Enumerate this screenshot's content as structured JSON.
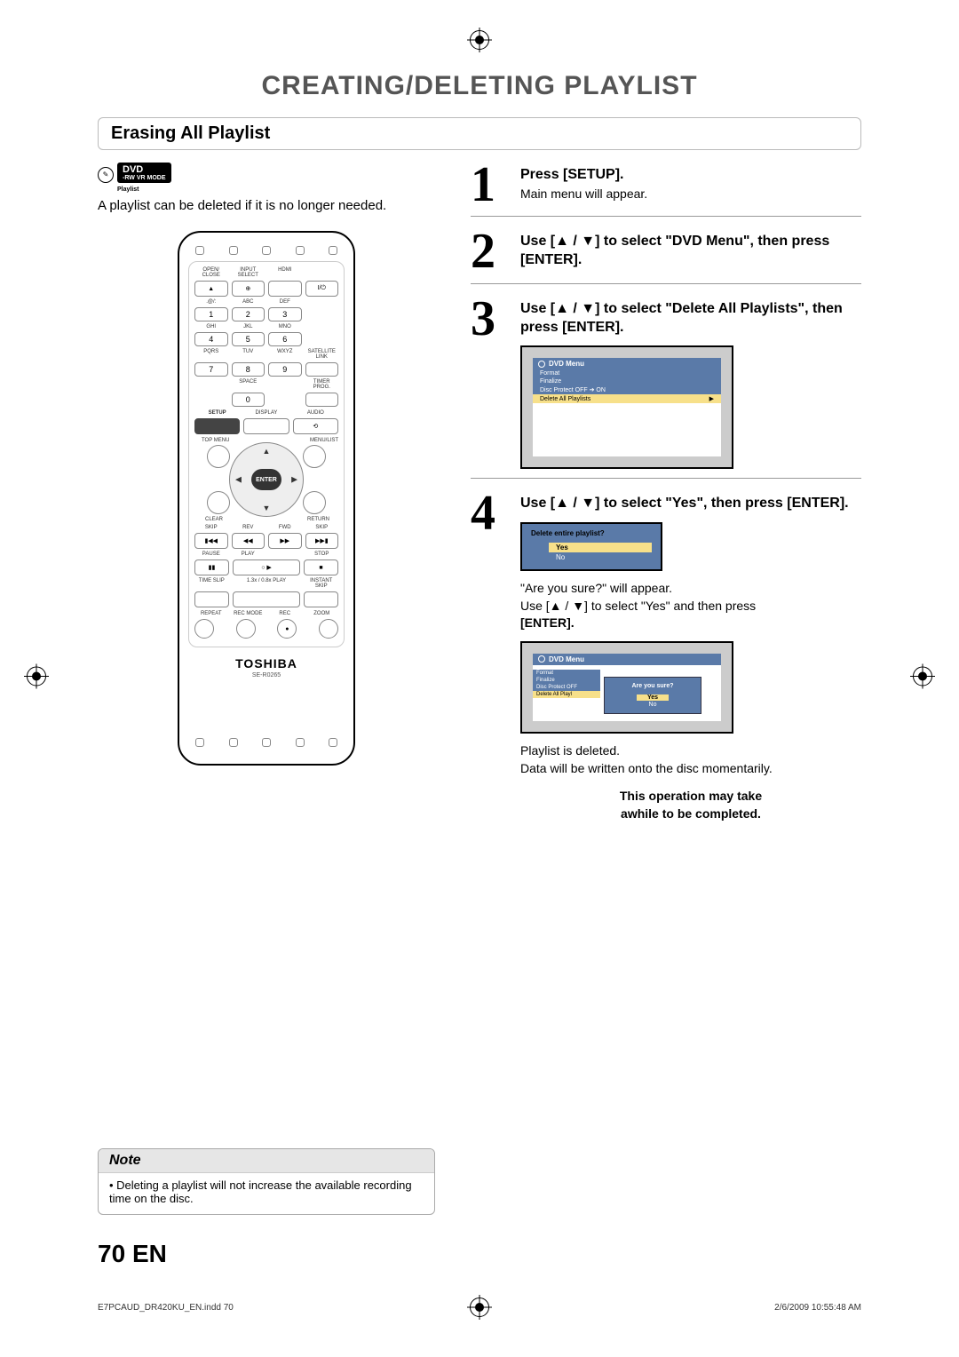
{
  "page": {
    "title": "CREATING/DELETING PLAYLIST",
    "section": "Erasing All Playlist",
    "dvd_badge": "DVD",
    "dvd_badge_sub1": "-RW",
    "dvd_badge_sub2": "VR MODE",
    "dvd_badge_sub3": "Playlist",
    "intro": "A playlist can be deleted if it is no longer needed.",
    "page_number": "70",
    "page_lang": "EN",
    "footer_file": "E7PCAUD_DR420KU_EN.indd   70",
    "footer_date": "2/6/2009   10:55:48 AM"
  },
  "remote": {
    "labels": {
      "open_close": "OPEN/\nCLOSE",
      "input_select": "INPUT\nSELECT",
      "hdmi": "HDMI",
      "power_sym": "I/⏻",
      "abc": "ABC",
      "def": "DEF",
      "ghi": "GHI",
      "jkl": "JKL",
      "mno": "MNO",
      "pqrs": "PQRS",
      "tuv": "TUV",
      "wxyz": "WXYZ",
      "satellite_link": "SATELLITE\nLINK",
      "space": "SPACE",
      "timer_prog": "TIMER\nPROG.",
      "setup": "SETUP",
      "display": "DISPLAY",
      "audio": "AUDIO",
      "top_menu": "TOP MENU",
      "menu_list": "MENU/LIST",
      "enter": "ENTER",
      "clear": "CLEAR",
      "return": "RETURN",
      "skip": "SKIP",
      "rev": "REV",
      "fwd": "FWD",
      "pause": "PAUSE",
      "play": "PLAY",
      "stop": "STOP",
      "time_slip": "TIME SLIP",
      "speed": "1.3x / 0.8x PLAY",
      "instant_skip": "INSTANT SKIP",
      "repeat": "REPEAT",
      "rec_mode": "REC MODE",
      "rec": "REC",
      "zoom": "ZOOM",
      "brand": "TOSHIBA",
      "model": "SE-R0265"
    },
    "keypad": {
      "k1": "1",
      "k2": "2",
      "k3": "3",
      "k4": "4",
      "k5": "5",
      "k6": "6",
      "k7": "7",
      "k8": "8",
      "k9": "9",
      "k0": "0"
    }
  },
  "steps": {
    "s1": {
      "num": "1",
      "title": "Press [SETUP].",
      "sub": "Main menu will appear."
    },
    "s2": {
      "num": "2",
      "title": "Use [▲ / ▼] to select \"DVD Menu\", then press [ENTER]."
    },
    "s3": {
      "num": "3",
      "title": "Use [▲ / ▼] to select \"Delete All Playlists\", then press [ENTER]."
    },
    "s4": {
      "num": "4",
      "title": "Use [▲ / ▼] to select \"Yes\", then press [ENTER]."
    }
  },
  "osd1": {
    "header": "DVD Menu",
    "items": {
      "i1": "Format",
      "i2": "Finalize",
      "i3": "Disc Protect OFF ➔ ON",
      "i4": "Delete All Playlists"
    }
  },
  "osd_confirm": {
    "title": "Delete entire playlist?",
    "yes": "Yes",
    "no": "No"
  },
  "after4": {
    "line1": "\"Are you sure?\" will appear.",
    "line2a": "Use [▲ / ▼] to select \"Yes\" and then press ",
    "line2b": "[ENTER]."
  },
  "osd2": {
    "header": "DVD Menu",
    "left": {
      "i1": "Format",
      "i2": "Finalize",
      "i3": "Disc Protect OFF",
      "i4": "Delete All Playl"
    },
    "popup": {
      "q": "Are you sure?",
      "yes": "Yes",
      "no": "No"
    }
  },
  "final": {
    "line1": "Playlist is deleted.",
    "line2": "Data will be written onto the disc momentarily.",
    "warn1": "This operation may take",
    "warn2": "awhile to be completed."
  },
  "note": {
    "title": "Note",
    "body": "Deleting a playlist will not increase the available recording time on the disc."
  }
}
